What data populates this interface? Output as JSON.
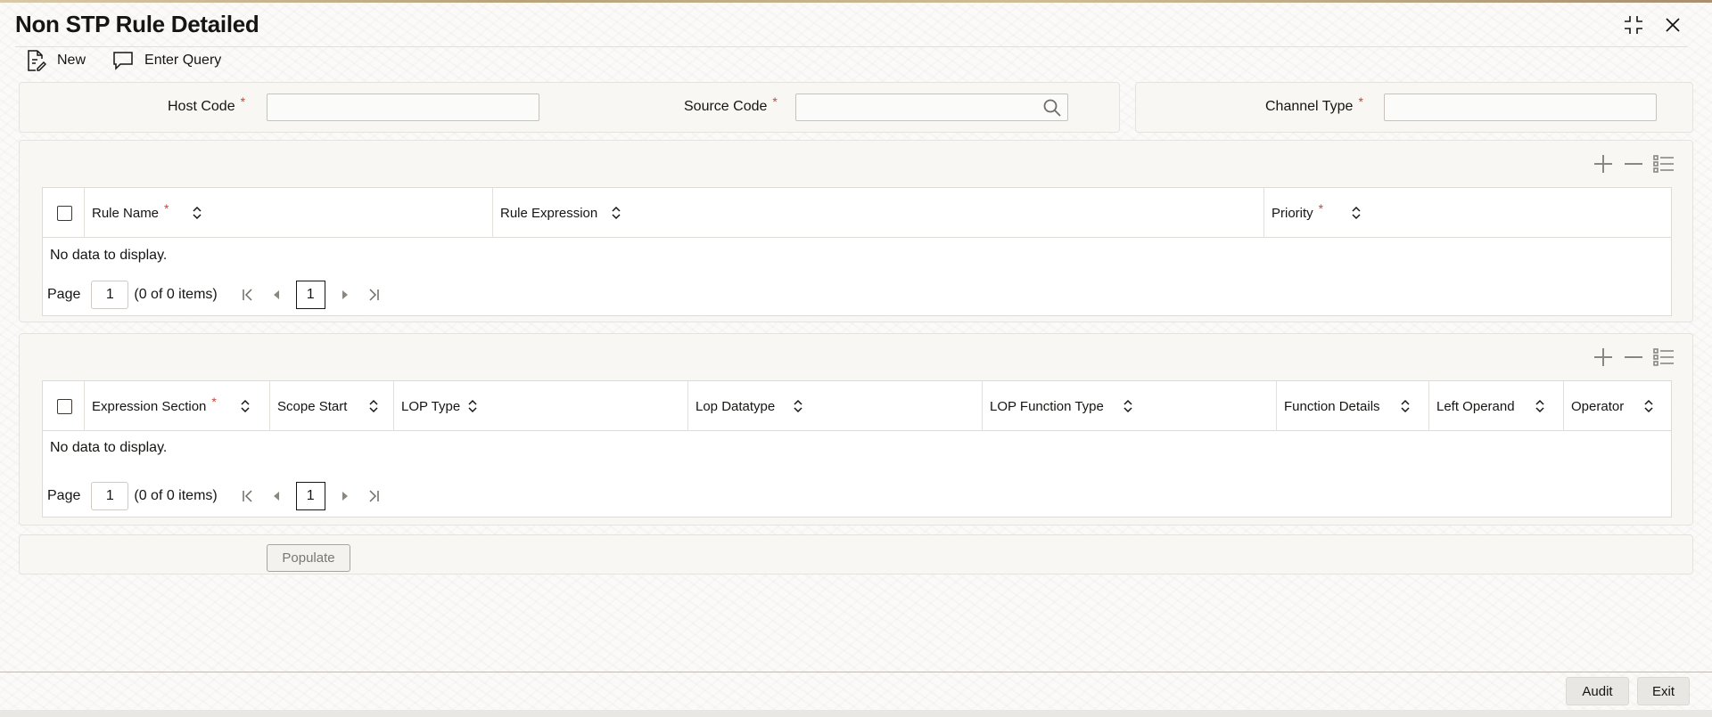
{
  "window": {
    "title": "Non STP Rule Detailed",
    "controls": [
      {
        "name": "minimize-icon"
      },
      {
        "name": "close-icon"
      }
    ]
  },
  "toolbar": {
    "new_label": "New",
    "new_icon": "document-edit-icon",
    "enter_query_label": "Enter Query",
    "enter_query_icon": "chat-bubble-icon"
  },
  "header_fields": {
    "host_code": {
      "label": "Host Code",
      "required": "*",
      "value": ""
    },
    "source_code": {
      "label": "Source Code",
      "required": "*",
      "value": ""
    },
    "channel_type": {
      "label": "Channel Type",
      "required": "*",
      "value": ""
    }
  },
  "rules_grid": {
    "columns": [
      {
        "label": "Rule Name",
        "required": "*"
      },
      {
        "label": "Rule Expression",
        "required": ""
      },
      {
        "label": "Priority",
        "required": "*"
      }
    ],
    "empty_text": "No data to display.",
    "pager": {
      "page_label": "Page",
      "page_value": "1",
      "count_text": "(0 of 0 items)",
      "current_page": "1"
    }
  },
  "expression_grid": {
    "columns": [
      {
        "label": "Expression Section",
        "required": "*"
      },
      {
        "label": "Scope Start",
        "required": ""
      },
      {
        "label": "LOP Type",
        "required": ""
      },
      {
        "label": "Lop Datatype",
        "required": ""
      },
      {
        "label": "LOP Function Type",
        "required": ""
      },
      {
        "label": "Function Details",
        "required": ""
      },
      {
        "label": "Left Operand",
        "required": ""
      },
      {
        "label": "Operator",
        "required": ""
      }
    ],
    "empty_text": "No data to display.",
    "pager": {
      "page_label": "Page",
      "page_value": "1",
      "count_text": "(0 of 0 items)",
      "current_page": "1"
    }
  },
  "populate_label": "Populate",
  "footer": {
    "audit_label": "Audit",
    "exit_label": "Exit"
  },
  "colors": {
    "required": "#c74634",
    "text": "#161513",
    "border": "#c7c3bc"
  }
}
